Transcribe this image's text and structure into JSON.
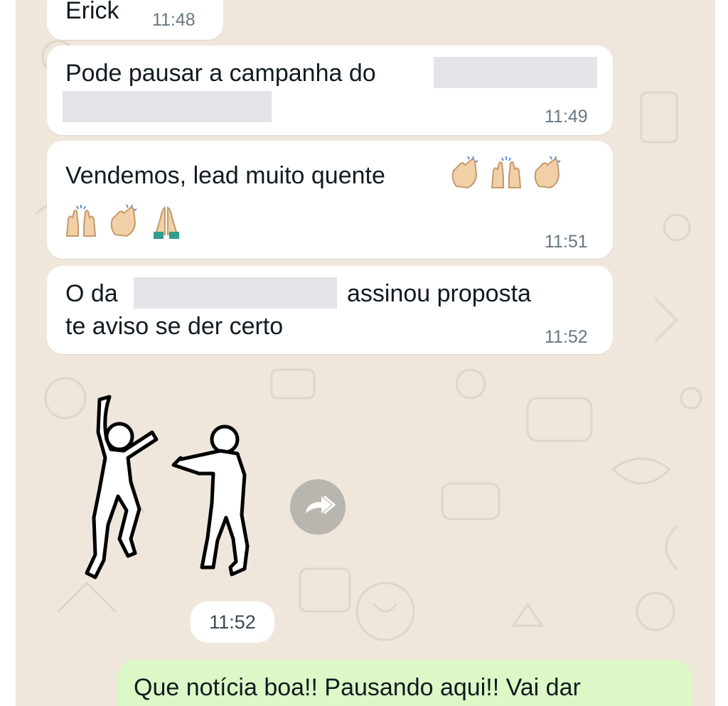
{
  "messages": [
    {
      "id": "m1",
      "text": "Erick",
      "time": "11:48"
    },
    {
      "id": "m2",
      "text": "Pode pausar a campanha do",
      "time": "11:49"
    },
    {
      "id": "m3",
      "text": "Vendemos, lead muito quente",
      "time": "11:51",
      "emoji_row1": [
        "clapping-hands-emoji",
        "raising-hands-emoji",
        "clapping-hands-emoji"
      ],
      "emoji_row2": [
        "raising-hands-emoji",
        "clapping-hands-emoji",
        "folded-hands-emoji"
      ]
    },
    {
      "id": "m4",
      "line1_prefix": "O da",
      "line1_suffix": "assinou proposta",
      "line2": "te aviso se der certo",
      "time": "11:52"
    }
  ],
  "sticker": {
    "icon": "dancing-figures-sticker",
    "time": "11:52",
    "forward_icon": "forward-icon"
  },
  "outgoing": {
    "text": "Que notícia boa!! Pausando aqui!! Vai dar"
  },
  "colors": {
    "wallpaper": "#efe7dc",
    "incoming": "#ffffff",
    "outgoing": "#dcf8c6",
    "timestamp": "#667781",
    "redaction": "#e3e4e7"
  }
}
